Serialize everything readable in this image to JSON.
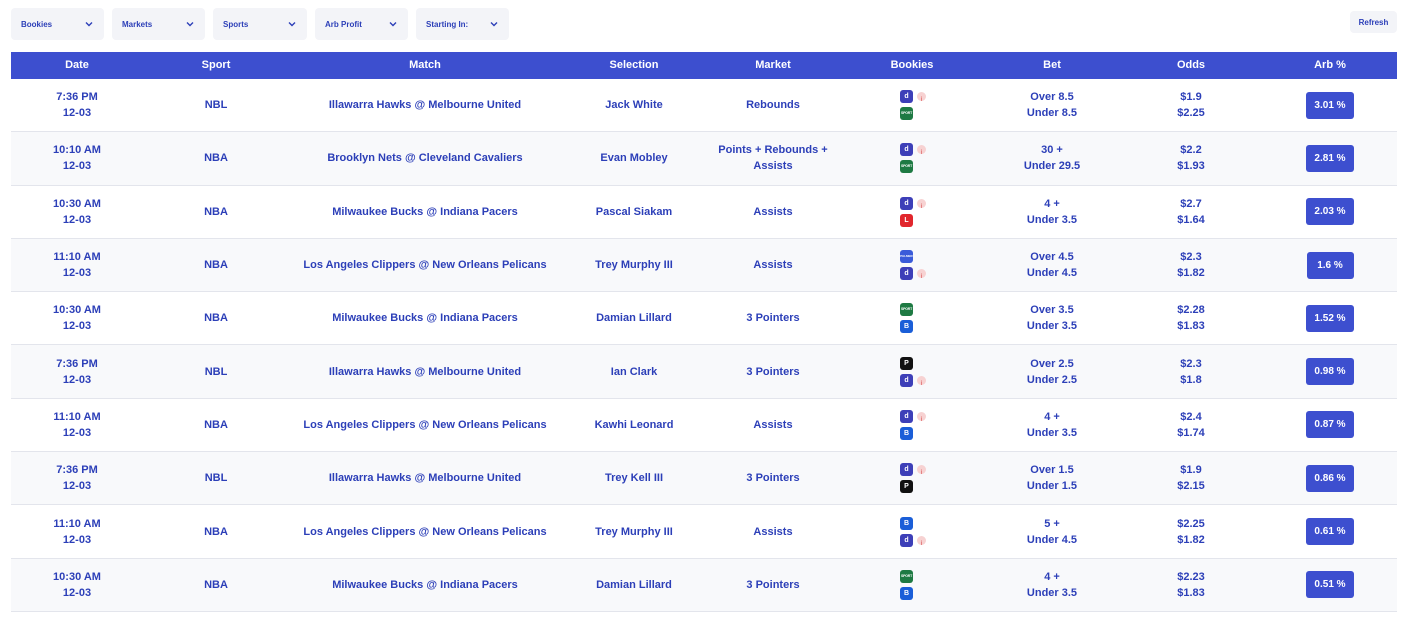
{
  "filters": {
    "bookies": "Bookies",
    "markets": "Markets",
    "sports": "Sports",
    "arb_profit": "Arb Profit",
    "starting_in": "Starting In:",
    "refresh": "Refresh"
  },
  "columns": {
    "date": "Date",
    "sport": "Sport",
    "match": "Match",
    "selection": "Selection",
    "market": "Market",
    "bookies": "Bookies",
    "bet": "Bet",
    "odds": "Odds",
    "arb": "Arb %"
  },
  "colors": {
    "header_bg": "#3d4fcf",
    "accent_text": "#2c3fb8"
  },
  "rows": [
    {
      "time": "7:36 PM",
      "date": "12-03",
      "sport": "NBL",
      "match": "Illawarra Hawks @ Melbourne United",
      "selection": "Jack White",
      "market": "Rebounds",
      "bookies": [
        "dabble",
        "sportsbet"
      ],
      "bet1": "Over 8.5",
      "bet2": "Under 8.5",
      "odds1": "$1.9",
      "odds2": "$2.25",
      "arb": "3.01 %"
    },
    {
      "time": "10:10 AM",
      "date": "12-03",
      "sport": "NBA",
      "match": "Brooklyn Nets @ Cleveland Cavaliers",
      "selection": "Evan Mobley",
      "market": "Points + Rebounds + Assists",
      "bookies": [
        "dabble",
        "sportsbet"
      ],
      "bet1": "30 +",
      "bet2": "Under 29.5",
      "odds1": "$2.2",
      "odds2": "$1.93",
      "arb": "2.81 %"
    },
    {
      "time": "10:30 AM",
      "date": "12-03",
      "sport": "NBA",
      "match": "Milwaukee Bucks @ Indiana Pacers",
      "selection": "Pascal Siakam",
      "market": "Assists",
      "bookies": [
        "dabble",
        "ladbrokes"
      ],
      "bet1": "4 +",
      "bet2": "Under 3.5",
      "odds1": "$2.7",
      "odds2": "$1.64",
      "arb": "2.03 %"
    },
    {
      "time": "11:10 AM",
      "date": "12-03",
      "sport": "NBA",
      "match": "Los Angeles Clippers @ New Orleans Pelicans",
      "selection": "Trey Murphy III",
      "market": "Assists",
      "bookies": [
        "palmerbet",
        "dabble"
      ],
      "bet1": "Over 4.5",
      "bet2": "Under 4.5",
      "odds1": "$2.3",
      "odds2": "$1.82",
      "arb": "1.6 %"
    },
    {
      "time": "10:30 AM",
      "date": "12-03",
      "sport": "NBA",
      "match": "Milwaukee Bucks @ Indiana Pacers",
      "selection": "Damian Lillard",
      "market": "3 Pointers",
      "bookies": [
        "sportsbet",
        "beteasy"
      ],
      "bet1": "Over 3.5",
      "bet2": "Under 3.5",
      "odds1": "$2.28",
      "odds2": "$1.83",
      "arb": "1.52 %"
    },
    {
      "time": "7:36 PM",
      "date": "12-03",
      "sport": "NBL",
      "match": "Illawarra Hawks @ Melbourne United",
      "selection": "Ian Clark",
      "market": "3 Pointers",
      "bookies": [
        "pointsbet",
        "dabble"
      ],
      "bet1": "Over 2.5",
      "bet2": "Under 2.5",
      "odds1": "$2.3",
      "odds2": "$1.8",
      "arb": "0.98 %"
    },
    {
      "time": "11:10 AM",
      "date": "12-03",
      "sport": "NBA",
      "match": "Los Angeles Clippers @ New Orleans Pelicans",
      "selection": "Kawhi Leonard",
      "market": "Assists",
      "bookies": [
        "dabble",
        "beteasy"
      ],
      "bet1": "4 +",
      "bet2": "Under 3.5",
      "odds1": "$2.4",
      "odds2": "$1.74",
      "arb": "0.87 %"
    },
    {
      "time": "7:36 PM",
      "date": "12-03",
      "sport": "NBL",
      "match": "Illawarra Hawks @ Melbourne United",
      "selection": "Trey Kell III",
      "market": "3 Pointers",
      "bookies": [
        "dabble",
        "pointsbet"
      ],
      "bet1": "Over 1.5",
      "bet2": "Under 1.5",
      "odds1": "$1.9",
      "odds2": "$2.15",
      "arb": "0.86 %"
    },
    {
      "time": "11:10 AM",
      "date": "12-03",
      "sport": "NBA",
      "match": "Los Angeles Clippers @ New Orleans Pelicans",
      "selection": "Trey Murphy III",
      "market": "Assists",
      "bookies": [
        "beteasy",
        "dabble"
      ],
      "bet1": "5 +",
      "bet2": "Under 4.5",
      "odds1": "$2.25",
      "odds2": "$1.82",
      "arb": "0.61 %"
    },
    {
      "time": "10:30 AM",
      "date": "12-03",
      "sport": "NBA",
      "match": "Milwaukee Bucks @ Indiana Pacers",
      "selection": "Damian Lillard",
      "market": "3 Pointers",
      "bookies": [
        "sportsbet",
        "beteasy"
      ],
      "bet1": "4 +",
      "bet2": "Under 3.5",
      "odds1": "$2.23",
      "odds2": "$1.83",
      "arb": "0.51 %"
    }
  ]
}
